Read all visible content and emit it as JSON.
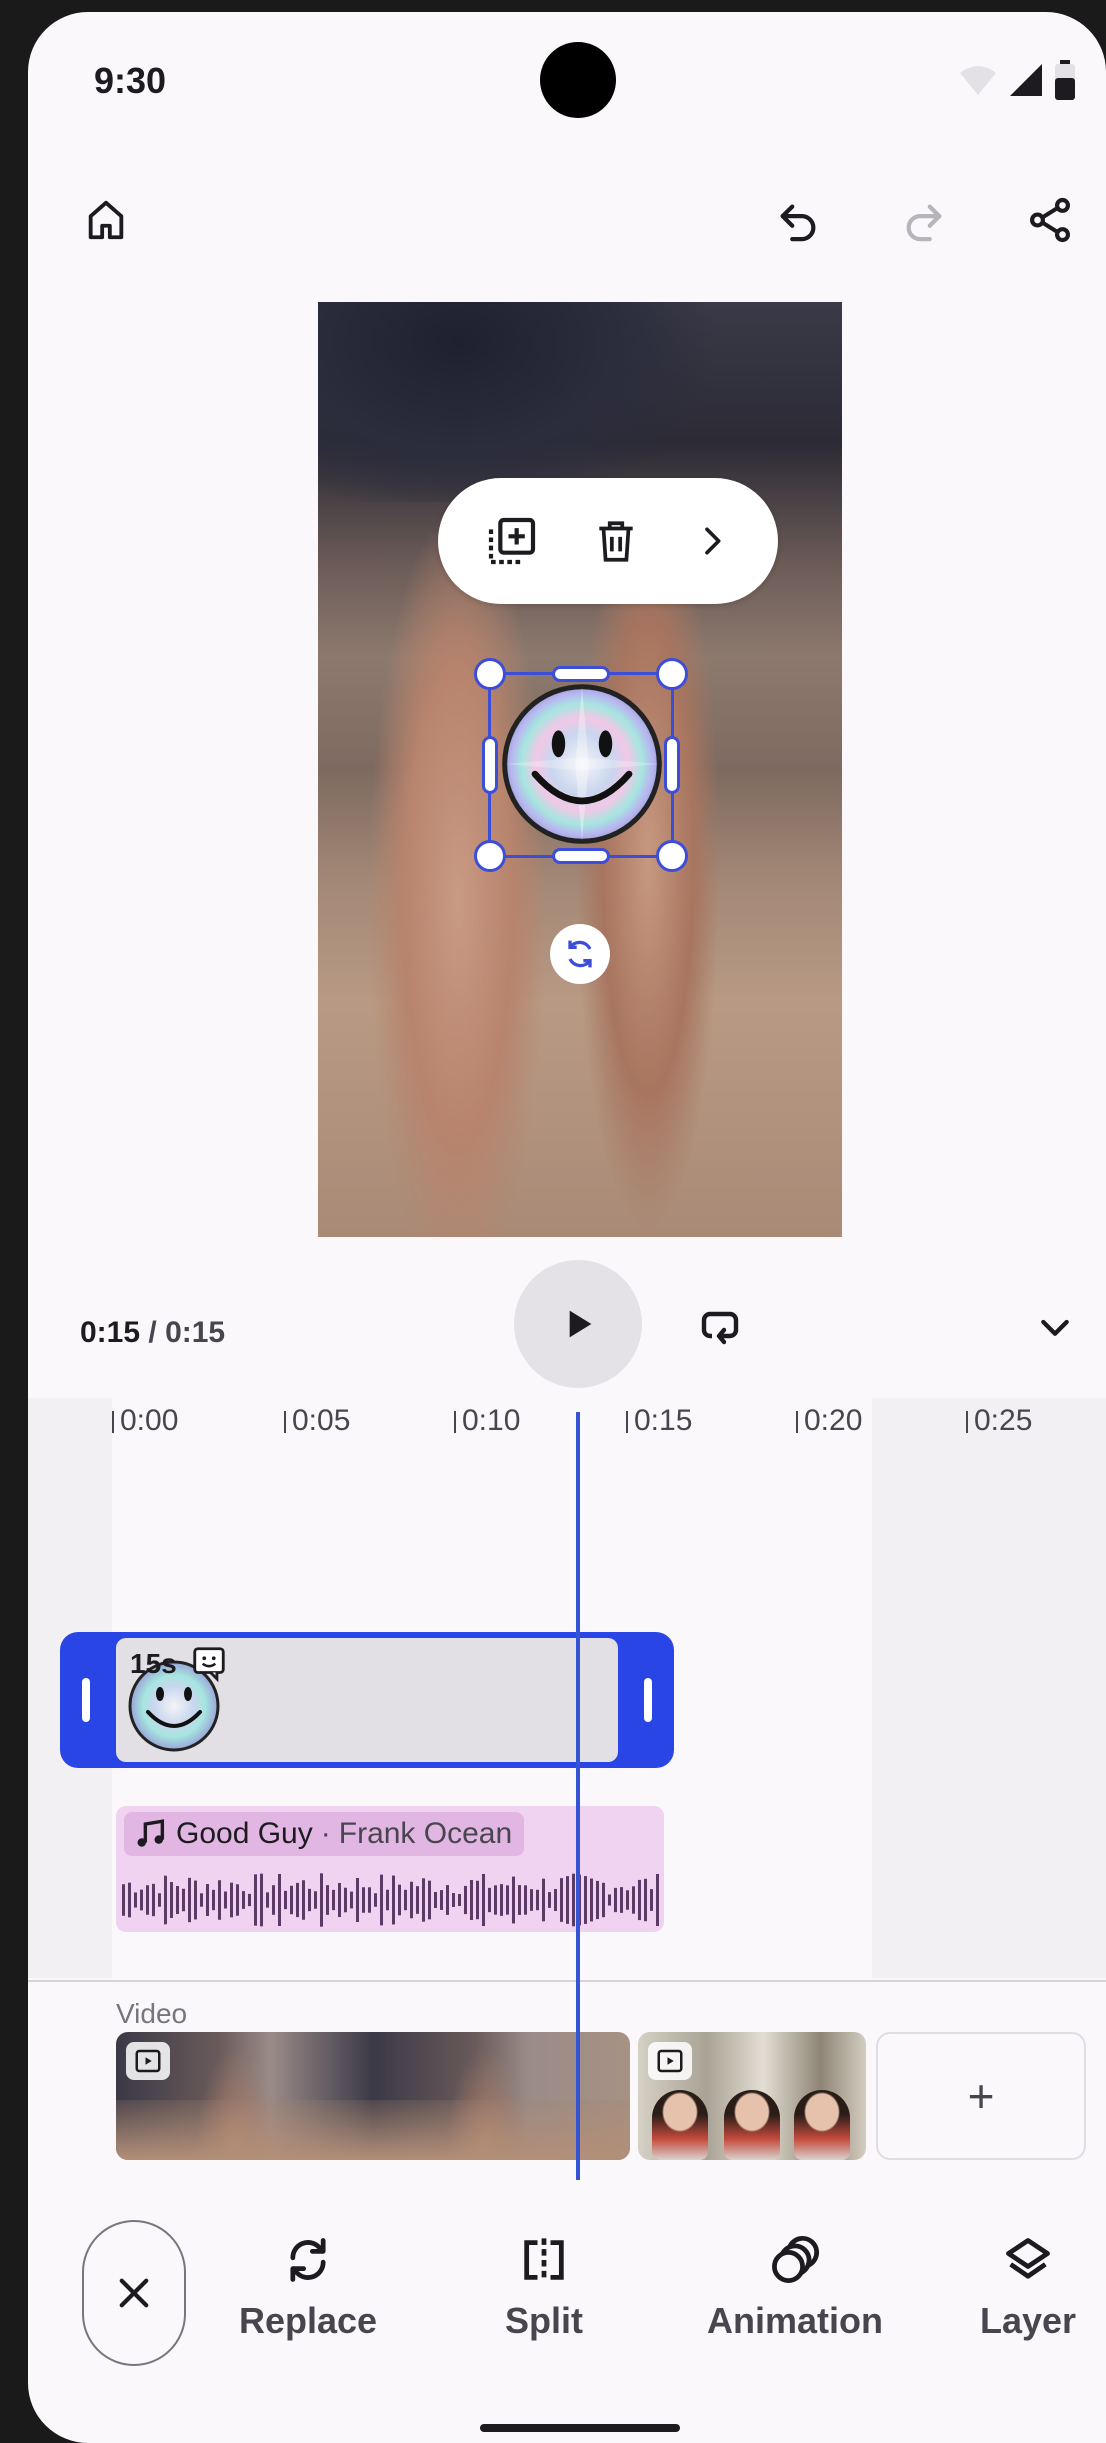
{
  "status_bar": {
    "time": "9:30"
  },
  "top_bar": {
    "home_icon": "home-icon",
    "undo_icon": "undo-icon",
    "redo_icon": "redo-icon",
    "share_icon": "share-icon"
  },
  "sticker_toolbar": {
    "duplicate_icon": "duplicate-icon",
    "delete_icon": "delete-icon",
    "more_icon": "chevron-right-icon"
  },
  "player": {
    "current_time": "0:15",
    "separator": " / ",
    "total_time": "0:15"
  },
  "ruler": [
    "0:00",
    "0:05",
    "0:10",
    "0:15",
    "0:20",
    "0:25"
  ],
  "sticker_clip": {
    "duration": "15s"
  },
  "audio_clip": {
    "title": "Good Guy",
    "separator": " · ",
    "artist": "Frank Ocean"
  },
  "video_track": {
    "label": "Video",
    "add_label": "+"
  },
  "bottom_tools": {
    "replace": "Replace",
    "split": "Split",
    "animation": "Animation",
    "layer": "Layer"
  },
  "colors": {
    "accent": "#2a45e5",
    "audio_bg": "#f0d3f0",
    "audio_label_bg": "#e2b6e3"
  }
}
